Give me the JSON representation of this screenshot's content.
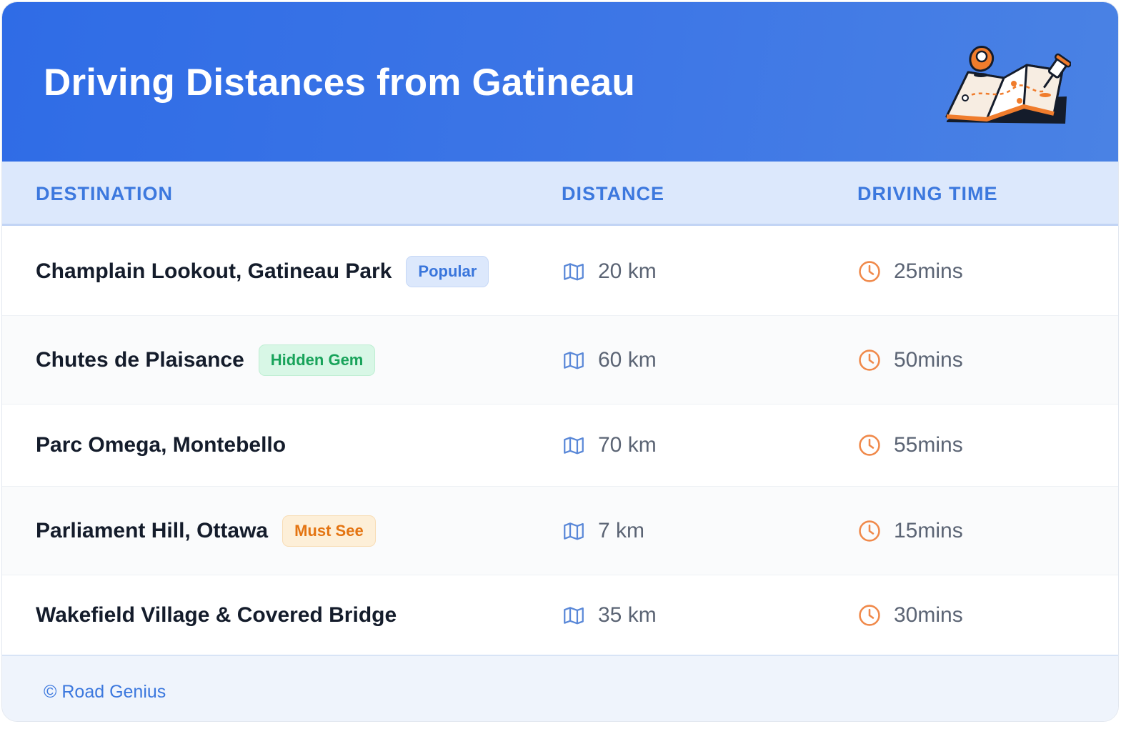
{
  "header": {
    "title": "Driving Distances from Gatineau"
  },
  "table": {
    "columns": [
      "DESTINATION",
      "DISTANCE",
      "DRIVING TIME"
    ],
    "rows": [
      {
        "destination": "Champlain Lookout, Gatineau Park",
        "badge": "Popular",
        "badge_color": "#3a76dc",
        "distance": "20 km",
        "time": "25mins"
      },
      {
        "destination": "Chutes de Plaisance",
        "badge": "Hidden Gem",
        "badge_color": "#18a35a",
        "distance": "60 km",
        "time": "50mins"
      },
      {
        "destination": "Parc Omega, Montebello",
        "badge": "",
        "badge_color": "",
        "distance": "70 km",
        "time": "55mins"
      },
      {
        "destination": "Parliament Hill, Ottawa",
        "badge": "Must See",
        "badge_color": "#e47411",
        "distance": "7 km",
        "time": "15mins"
      },
      {
        "destination": "Wakefield Village & Covered Bridge",
        "badge": "",
        "badge_color": "",
        "distance": "35 km",
        "time": "30mins"
      }
    ]
  },
  "icons": {
    "distance": "map-icon",
    "time": "clock-icon",
    "illustration": "folded-map-with-pins-icon"
  },
  "footer": {
    "text": "© Road Genius"
  },
  "colors": {
    "header_gradient_start": "#2f6ce6",
    "accent": "#3c78de",
    "map_icon": "#5a88d8",
    "clock_icon": "#f0894a"
  }
}
